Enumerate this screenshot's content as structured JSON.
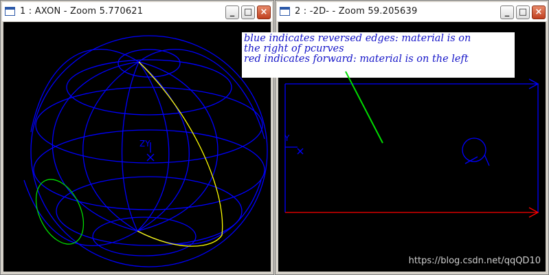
{
  "windows": {
    "left": {
      "title": "1 : AXON - Zoom 5.770621",
      "axis_label": "ZY"
    },
    "right": {
      "title": "2 : -2D- - Zoom 59.205639",
      "axis_label": "Y"
    }
  },
  "titlebar_buttons": {
    "minimize": "_",
    "maximize": "□",
    "close": "×"
  },
  "annotation": {
    "line1": "blue indicates reversed edges: material is on",
    "line2": "the right of pcurves",
    "line3": "red indicates forward: material is on the left"
  },
  "watermark": "https://blog.csdn.net/qqQD10",
  "colors": {
    "reversed_edge": "#0000ff",
    "forward_edge": "#ff0000",
    "seam_edge": "#ffff00",
    "pointer": "#00dd00",
    "annotation_text": "#1414c8",
    "viewport_bg": "#000000"
  }
}
